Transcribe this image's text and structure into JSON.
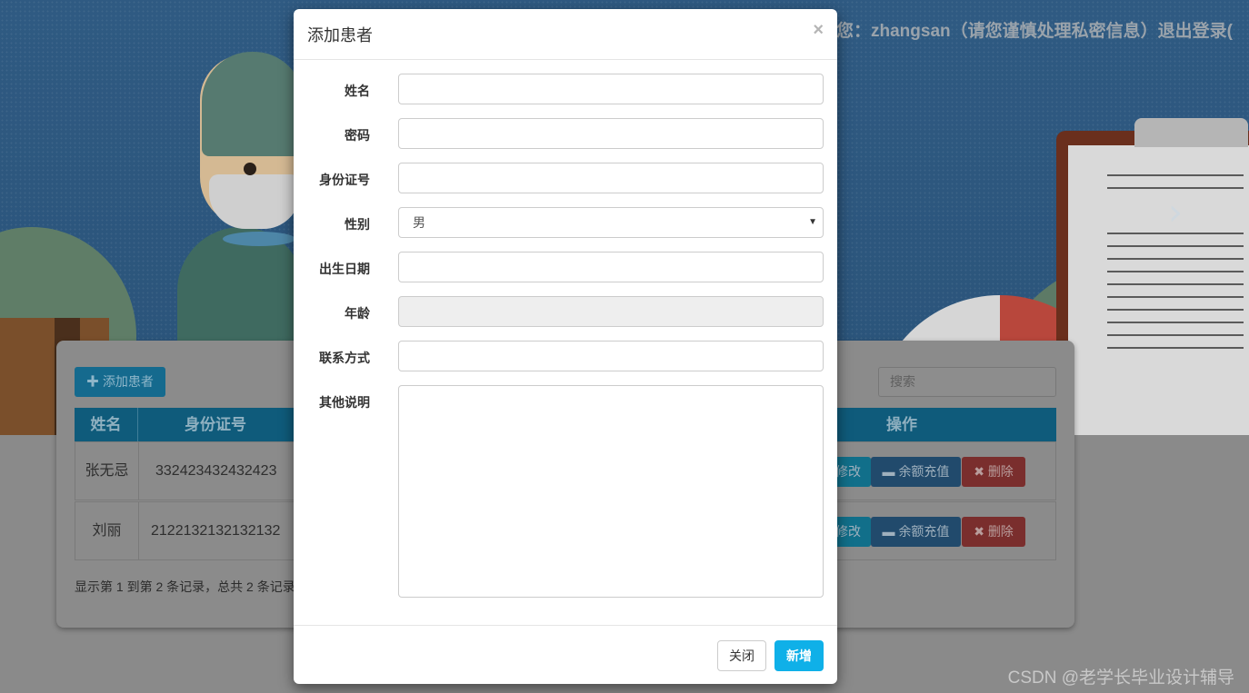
{
  "header": {
    "user_text": "您：zhangsan（请您谨慎处理私密信息）退出登录("
  },
  "toolbar": {
    "add_label": "添加患者",
    "search_placeholder": "搜索"
  },
  "table": {
    "columns": [
      "姓名",
      "身份证号",
      "操作"
    ],
    "rows": [
      {
        "name": "张无忌",
        "id_number": "332423432432423"
      },
      {
        "name": "刘丽",
        "id_number": "2122132132132132"
      }
    ],
    "actions": {
      "edit": "修改",
      "charge": "余额充值",
      "delete": "删除"
    }
  },
  "pagination": {
    "info": "显示第 1 到第 2 条记录，总共 2 条记录"
  },
  "modal": {
    "title": "添加患者",
    "close_icon": "×",
    "fields": {
      "name": {
        "label": "姓名",
        "value": ""
      },
      "password": {
        "label": "密码",
        "value": ""
      },
      "id_number": {
        "label": "身份证号",
        "value": ""
      },
      "gender": {
        "label": "性别",
        "value": "男"
      },
      "birth_date": {
        "label": "出生日期",
        "value": ""
      },
      "age": {
        "label": "年龄",
        "value": ""
      },
      "contact": {
        "label": "联系方式",
        "value": ""
      },
      "notes": {
        "label": "其他说明",
        "value": ""
      }
    },
    "buttons": {
      "close": "关闭",
      "submit": "新增"
    }
  },
  "watermark": "CSDN @老学长毕业设计辅导",
  "colors": {
    "primary_button": "#0fb0e8",
    "table_header": "#0f5b7b",
    "delete_button": "#7a2e2d"
  }
}
